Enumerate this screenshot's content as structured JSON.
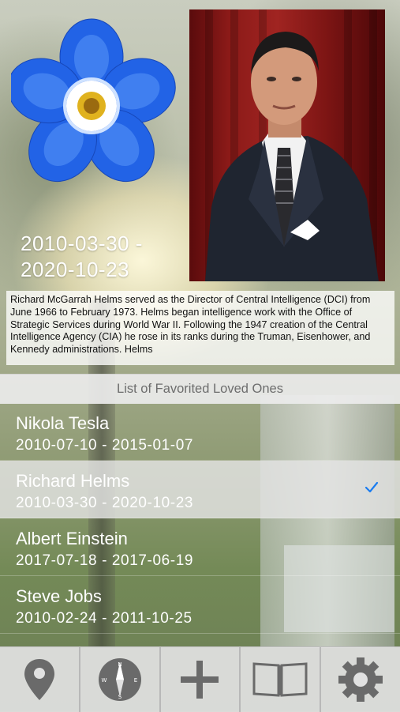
{
  "memorial": {
    "dates_start": "2010-03-30 -",
    "dates_end": "2020-10-23",
    "bio": "Richard McGarrah Helms served as the Director of Central Intelligence (DCI) from June 1966 to February 1973. Helms began intelligence work with the Office of Strategic Services during World War II. Following the 1947 creation of the Central Intelligence Agency (CIA) he rose in its ranks during the Truman, Eisenhower, and Kennedy administrations. Helms"
  },
  "list": {
    "header": "List of Favorited Loved Ones",
    "items": [
      {
        "name": "Nikola Tesla",
        "range": "2010-07-10  -  2015-01-07",
        "selected": false
      },
      {
        "name": "Richard Helms",
        "range": "2010-03-30  -  2020-10-23",
        "selected": true
      },
      {
        "name": "Albert Einstein",
        "range": "2017-07-18  -  2017-06-19",
        "selected": false
      },
      {
        "name": "Steve Jobs",
        "range": "2010-02-24  -  2011-10-25",
        "selected": false
      }
    ]
  },
  "tabbar": {
    "tabs": [
      {
        "icon": "map-pin-icon"
      },
      {
        "icon": "compass-icon",
        "compass_letters": [
          "N",
          "E",
          "S",
          "W"
        ]
      },
      {
        "icon": "plus-icon"
      },
      {
        "icon": "book-icon"
      },
      {
        "icon": "gear-icon"
      }
    ]
  },
  "colors": {
    "check": "#1a7cf0",
    "icon": "#6a6a6a",
    "flower_petal": "#1f5fe0",
    "portrait_curtain": "#8b1a18"
  }
}
